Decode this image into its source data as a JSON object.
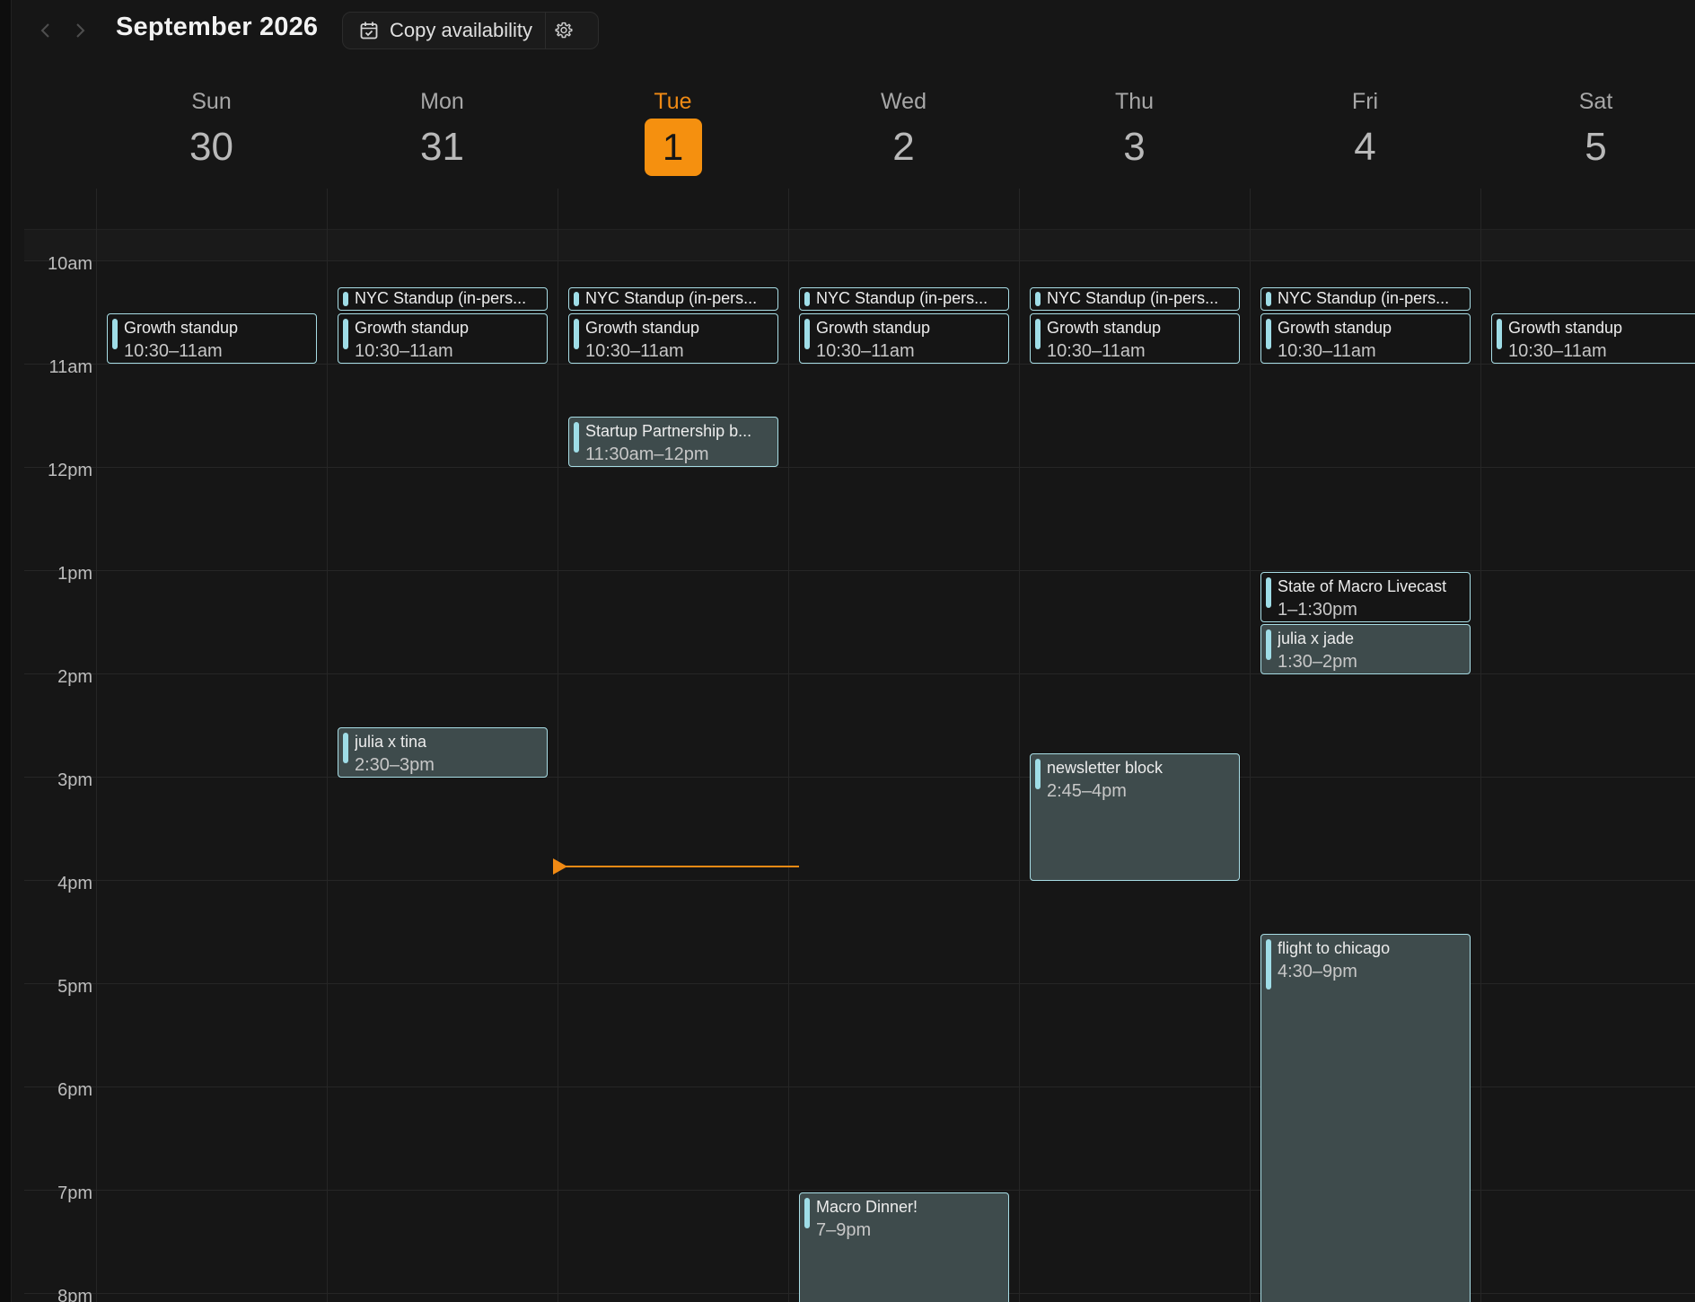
{
  "toolbar": {
    "month_title": "September 2026",
    "copy_label": "Copy availability"
  },
  "days": [
    {
      "name": "Sun",
      "num": "30"
    },
    {
      "name": "Mon",
      "num": "31"
    },
    {
      "name": "Tue",
      "num": "1",
      "today": true
    },
    {
      "name": "Wed",
      "num": "2"
    },
    {
      "name": "Thu",
      "num": "3"
    },
    {
      "name": "Fri",
      "num": "4"
    },
    {
      "name": "Sat",
      "num": "5"
    }
  ],
  "hours": [
    "10am",
    "11am",
    "12pm",
    "1pm",
    "2pm",
    "3pm",
    "4pm",
    "5pm",
    "6pm",
    "7pm",
    "8pm"
  ],
  "events": {
    "sun": {
      "growth": {
        "title": "Growth standup",
        "time": "10:30–11am"
      }
    },
    "mon": {
      "nyc": {
        "title": "NYC Standup (in-pers..."
      },
      "growth": {
        "title": "Growth standup",
        "time": "10:30–11am"
      },
      "julia_tina": {
        "title": "julia x tina",
        "time": "2:30–3pm"
      }
    },
    "tue": {
      "nyc": {
        "title": "NYC Standup (in-pers..."
      },
      "growth": {
        "title": "Growth standup",
        "time": "10:30–11am"
      },
      "startup": {
        "title": "Startup Partnership b...",
        "time": "11:30am–12pm"
      }
    },
    "wed": {
      "nyc": {
        "title": "NYC Standup (in-pers..."
      },
      "growth": {
        "title": "Growth standup",
        "time": "10:30–11am"
      },
      "macro_dinner": {
        "title": "Macro Dinner!",
        "time": "7–9pm"
      }
    },
    "thu": {
      "nyc": {
        "title": "NYC Standup (in-pers..."
      },
      "growth": {
        "title": "Growth standup",
        "time": "10:30–11am"
      },
      "newsletter": {
        "title": "newsletter block",
        "time": "2:45–4pm"
      }
    },
    "fri": {
      "nyc": {
        "title": "NYC Standup (in-pers..."
      },
      "growth": {
        "title": "Growth standup",
        "time": "10:30–11am"
      },
      "macro_livecast": {
        "title": "State of Macro Livecast",
        "time": "1–1:30pm"
      },
      "julia_jade": {
        "title": "julia x jade",
        "time": "1:30–2pm"
      },
      "flight": {
        "title": "flight to chicago",
        "time": "4:30–9pm"
      }
    },
    "sat": {
      "growth": {
        "title": "Growth standup",
        "time": "10:30–11am"
      }
    }
  },
  "colors": {
    "accent": "#f08a14",
    "event_border": "#a8dde5",
    "event_fill": "#3e4b4c",
    "background": "#161616"
  }
}
